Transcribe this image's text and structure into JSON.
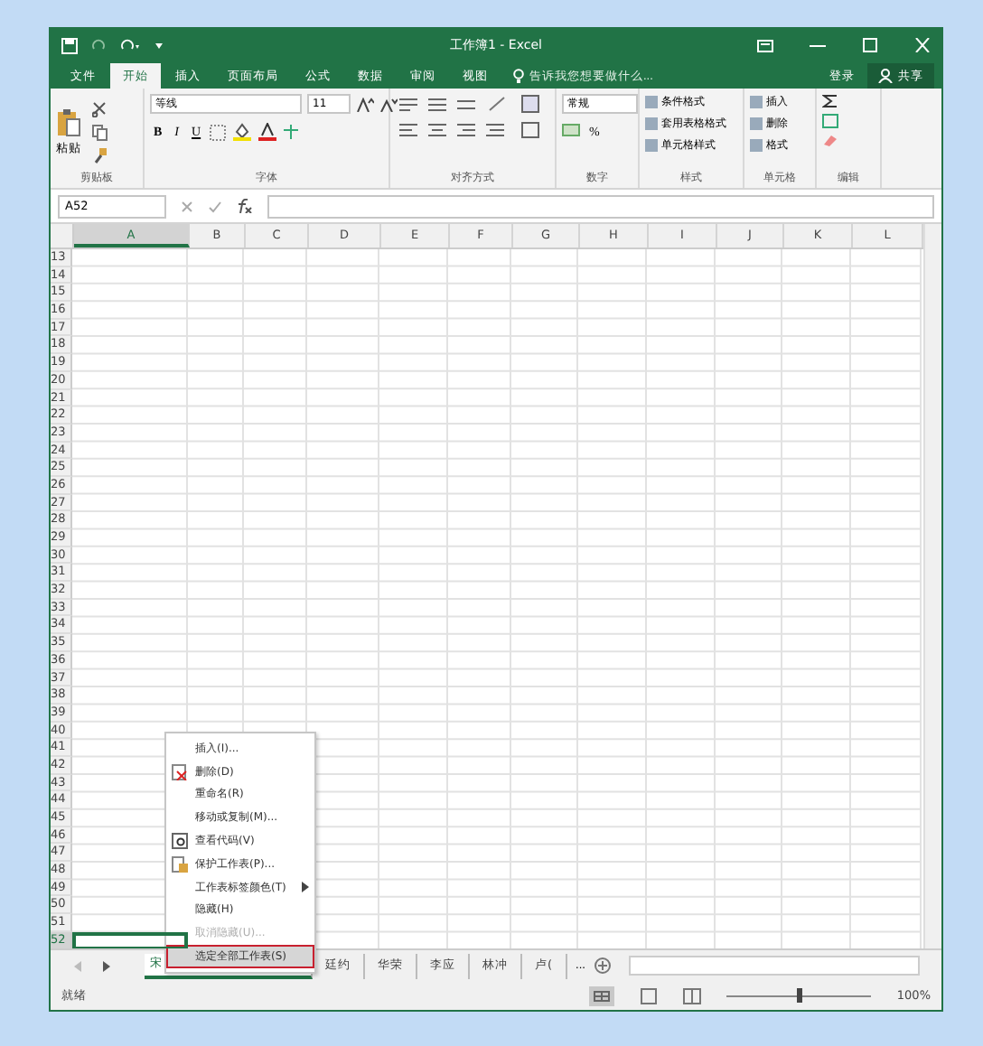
{
  "window": {
    "title": "工作簿1 - Excel"
  },
  "ribbon_tabs": [
    {
      "label": "文件",
      "selected": false
    },
    {
      "label": "开始",
      "selected": true
    },
    {
      "label": "插入",
      "selected": false
    },
    {
      "label": "页面布局",
      "selected": false
    },
    {
      "label": "公式",
      "selected": false
    },
    {
      "label": "数据",
      "selected": false
    },
    {
      "label": "审阅",
      "selected": false
    },
    {
      "label": "视图",
      "selected": false
    }
  ],
  "tell_me": {
    "placeholder": "告诉我您想要做什么..."
  },
  "account": {
    "sign_in": "登录",
    "share": "共享"
  },
  "clipboard": {
    "label": "剪贴板",
    "paste": "粘贴"
  },
  "font": {
    "label": "字体",
    "font_name": "等线",
    "font_size": "11",
    "bold": "B",
    "italic": "I",
    "underline": "U"
  },
  "alignment": {
    "label": "对齐方式"
  },
  "number": {
    "label": "数字",
    "format": "常规",
    "percent": "%"
  },
  "styles": {
    "label": "样式",
    "items": [
      "条件格式",
      "套用表格格式",
      "单元格样式"
    ]
  },
  "cells": {
    "label": "单元格",
    "items": [
      "插入",
      "删除",
      "格式"
    ]
  },
  "editing": {
    "label": "编辑"
  },
  "formula_bar": {
    "name_box": "A52"
  },
  "columns": [
    {
      "label": "A",
      "selected": true
    },
    {
      "label": "B",
      "selected": false
    },
    {
      "label": "C",
      "selected": false
    },
    {
      "label": "D",
      "selected": false
    },
    {
      "label": "E",
      "selected": false
    },
    {
      "label": "F",
      "selected": false
    },
    {
      "label": "G",
      "selected": false
    },
    {
      "label": "H",
      "selected": false
    },
    {
      "label": "I",
      "selected": false
    },
    {
      "label": "J",
      "selected": false
    },
    {
      "label": "K",
      "selected": false
    },
    {
      "label": "L",
      "selected": false
    }
  ],
  "rows": [
    {
      "label": "13",
      "selected": false
    },
    {
      "label": "14",
      "selected": false
    },
    {
      "label": "15",
      "selected": false
    },
    {
      "label": "16",
      "selected": false
    },
    {
      "label": "17",
      "selected": false
    },
    {
      "label": "18",
      "selected": false
    },
    {
      "label": "19",
      "selected": false
    },
    {
      "label": "20",
      "selected": false
    },
    {
      "label": "21",
      "selected": false
    },
    {
      "label": "22",
      "selected": false
    },
    {
      "label": "23",
      "selected": false
    },
    {
      "label": "24",
      "selected": false
    },
    {
      "label": "25",
      "selected": false
    },
    {
      "label": "26",
      "selected": false
    },
    {
      "label": "27",
      "selected": false
    },
    {
      "label": "28",
      "selected": false
    },
    {
      "label": "29",
      "selected": false
    },
    {
      "label": "30",
      "selected": false
    },
    {
      "label": "31",
      "selected": false
    },
    {
      "label": "32",
      "selected": false
    },
    {
      "label": "33",
      "selected": false
    },
    {
      "label": "34",
      "selected": false
    },
    {
      "label": "35",
      "selected": false
    },
    {
      "label": "36",
      "selected": false
    },
    {
      "label": "37",
      "selected": false
    },
    {
      "label": "38",
      "selected": false
    },
    {
      "label": "39",
      "selected": false
    },
    {
      "label": "40",
      "selected": false
    },
    {
      "label": "41",
      "selected": false
    },
    {
      "label": "42",
      "selected": false
    },
    {
      "label": "43",
      "selected": false
    },
    {
      "label": "44",
      "selected": false
    },
    {
      "label": "45",
      "selected": false
    },
    {
      "label": "46",
      "selected": false
    },
    {
      "label": "47",
      "selected": false
    },
    {
      "label": "48",
      "selected": false
    },
    {
      "label": "49",
      "selected": false
    },
    {
      "label": "50",
      "selected": false
    },
    {
      "label": "51",
      "selected": false
    },
    {
      "label": "52",
      "selected": true
    }
  ],
  "context_menu": [
    {
      "label": "插入(I)...",
      "kind": "plain",
      "disabled": false,
      "selected": false
    },
    {
      "label": "删除(D)",
      "kind": "delete",
      "disabled": false,
      "selected": false
    },
    {
      "label": "重命名(R)",
      "kind": "plain",
      "disabled": false,
      "selected": false
    },
    {
      "label": "移动或复制(M)...",
      "kind": "plain",
      "disabled": false,
      "selected": false
    },
    {
      "label": "查看代码(V)",
      "kind": "code",
      "disabled": false,
      "selected": false
    },
    {
      "label": "保护工作表(P)...",
      "kind": "protect",
      "disabled": false,
      "selected": false
    },
    {
      "label": "工作表标签颜色(T)",
      "kind": "submenu",
      "disabled": false,
      "selected": false
    },
    {
      "label": "隐藏(H)",
      "kind": "plain",
      "disabled": false,
      "selected": false
    },
    {
      "label": "取消隐藏(U)...",
      "kind": "plain",
      "disabled": true,
      "selected": false
    },
    {
      "label": "选定全部工作表(S)",
      "kind": "plain",
      "disabled": false,
      "selected": true
    }
  ],
  "sheet_tabs": [
    {
      "label": "宋",
      "selected": true
    },
    {
      "label": "廷约",
      "selected": false
    },
    {
      "label": "华荣",
      "selected": false
    },
    {
      "label": "李应",
      "selected": false
    },
    {
      "label": "林冲",
      "selected": false
    },
    {
      "label": "卢(",
      "selected": false
    }
  ],
  "more_tabs": "...",
  "status_bar": {
    "text": "就绪",
    "zoom": "100%",
    "zoom_slider": {
      "level": 0.5
    }
  }
}
